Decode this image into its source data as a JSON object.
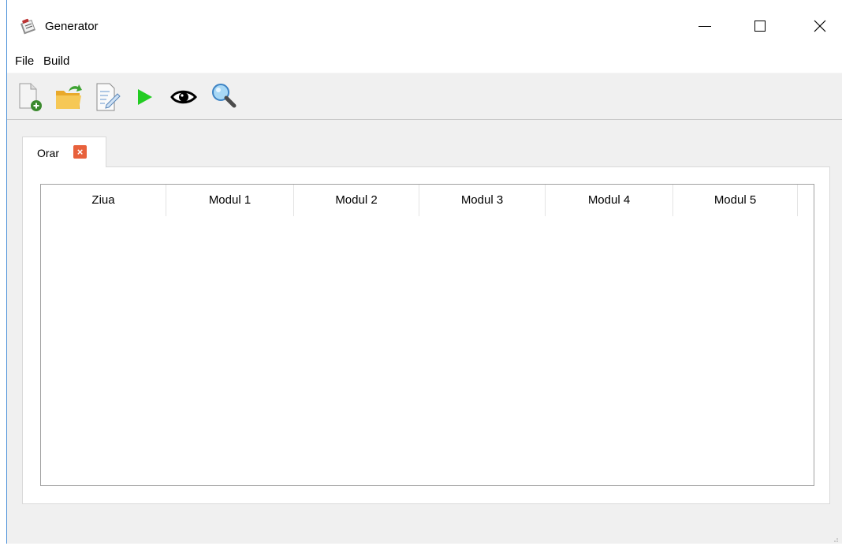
{
  "window": {
    "title": "Generator",
    "icon": "clipboard-calendar-icon"
  },
  "menu": {
    "items": [
      "File",
      "Build"
    ]
  },
  "toolbar": {
    "buttons": [
      {
        "icon": "new-file-icon"
      },
      {
        "icon": "open-folder-icon"
      },
      {
        "icon": "edit-document-icon"
      },
      {
        "icon": "play-icon",
        "color": "#22cc22"
      },
      {
        "icon": "eye-icon"
      },
      {
        "icon": "magnifier-icon"
      }
    ]
  },
  "tabs": [
    {
      "label": "Orar",
      "close_icon": "close-icon",
      "active": true
    }
  ],
  "table": {
    "columns": [
      "Ziua",
      "Modul 1",
      "Modul 2",
      "Modul 3",
      "Modul 4",
      "Modul 5"
    ],
    "rows": []
  },
  "colors": {
    "tab_close": "#e8613c",
    "window_border": "#4a8fd8"
  }
}
